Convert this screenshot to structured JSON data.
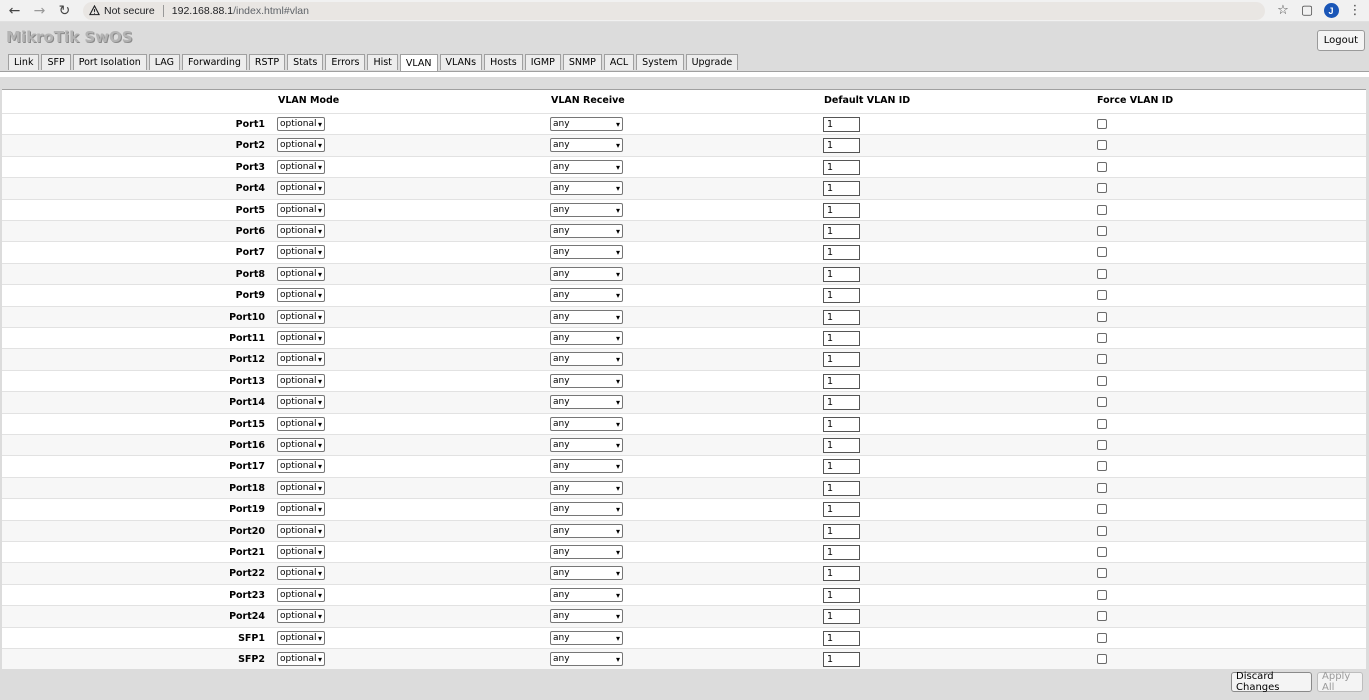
{
  "browser": {
    "security_label": "Not secure",
    "url_host": "192.168.88.1",
    "url_path": "/index.html#vlan",
    "profile_initial": "J"
  },
  "app": {
    "logo": "MikroTik SwOS",
    "logout_label": "Logout",
    "tabs": [
      "Link",
      "SFP",
      "Port Isolation",
      "LAG",
      "Forwarding",
      "RSTP",
      "Stats",
      "Errors",
      "Hist",
      "VLAN",
      "VLANs",
      "Hosts",
      "IGMP",
      "SNMP",
      "ACL",
      "System",
      "Upgrade"
    ],
    "active_tab": "VLAN"
  },
  "table": {
    "headers": [
      "VLAN Mode",
      "VLAN Receive",
      "Default VLAN ID",
      "Force VLAN ID"
    ],
    "rows": [
      {
        "port": "Port1",
        "mode": "optional",
        "receive": "any",
        "vid": "1",
        "force": false
      },
      {
        "port": "Port2",
        "mode": "optional",
        "receive": "any",
        "vid": "1",
        "force": false
      },
      {
        "port": "Port3",
        "mode": "optional",
        "receive": "any",
        "vid": "1",
        "force": false
      },
      {
        "port": "Port4",
        "mode": "optional",
        "receive": "any",
        "vid": "1",
        "force": false
      },
      {
        "port": "Port5",
        "mode": "optional",
        "receive": "any",
        "vid": "1",
        "force": false
      },
      {
        "port": "Port6",
        "mode": "optional",
        "receive": "any",
        "vid": "1",
        "force": false
      },
      {
        "port": "Port7",
        "mode": "optional",
        "receive": "any",
        "vid": "1",
        "force": false
      },
      {
        "port": "Port8",
        "mode": "optional",
        "receive": "any",
        "vid": "1",
        "force": false
      },
      {
        "port": "Port9",
        "mode": "optional",
        "receive": "any",
        "vid": "1",
        "force": false
      },
      {
        "port": "Port10",
        "mode": "optional",
        "receive": "any",
        "vid": "1",
        "force": false
      },
      {
        "port": "Port11",
        "mode": "optional",
        "receive": "any",
        "vid": "1",
        "force": false
      },
      {
        "port": "Port12",
        "mode": "optional",
        "receive": "any",
        "vid": "1",
        "force": false
      },
      {
        "port": "Port13",
        "mode": "optional",
        "receive": "any",
        "vid": "1",
        "force": false
      },
      {
        "port": "Port14",
        "mode": "optional",
        "receive": "any",
        "vid": "1",
        "force": false
      },
      {
        "port": "Port15",
        "mode": "optional",
        "receive": "any",
        "vid": "1",
        "force": false
      },
      {
        "port": "Port16",
        "mode": "optional",
        "receive": "any",
        "vid": "1",
        "force": false
      },
      {
        "port": "Port17",
        "mode": "optional",
        "receive": "any",
        "vid": "1",
        "force": false
      },
      {
        "port": "Port18",
        "mode": "optional",
        "receive": "any",
        "vid": "1",
        "force": false
      },
      {
        "port": "Port19",
        "mode": "optional",
        "receive": "any",
        "vid": "1",
        "force": false
      },
      {
        "port": "Port20",
        "mode": "optional",
        "receive": "any",
        "vid": "1",
        "force": false
      },
      {
        "port": "Port21",
        "mode": "optional",
        "receive": "any",
        "vid": "1",
        "force": false
      },
      {
        "port": "Port22",
        "mode": "optional",
        "receive": "any",
        "vid": "1",
        "force": false
      },
      {
        "port": "Port23",
        "mode": "optional",
        "receive": "any",
        "vid": "1",
        "force": false
      },
      {
        "port": "Port24",
        "mode": "optional",
        "receive": "any",
        "vid": "1",
        "force": false
      },
      {
        "port": "SFP1",
        "mode": "optional",
        "receive": "any",
        "vid": "1",
        "force": false
      },
      {
        "port": "SFP2",
        "mode": "optional",
        "receive": "any",
        "vid": "1",
        "force": false
      }
    ]
  },
  "footer": {
    "discard_label": "Discard Changes",
    "apply_label": "Apply All"
  }
}
